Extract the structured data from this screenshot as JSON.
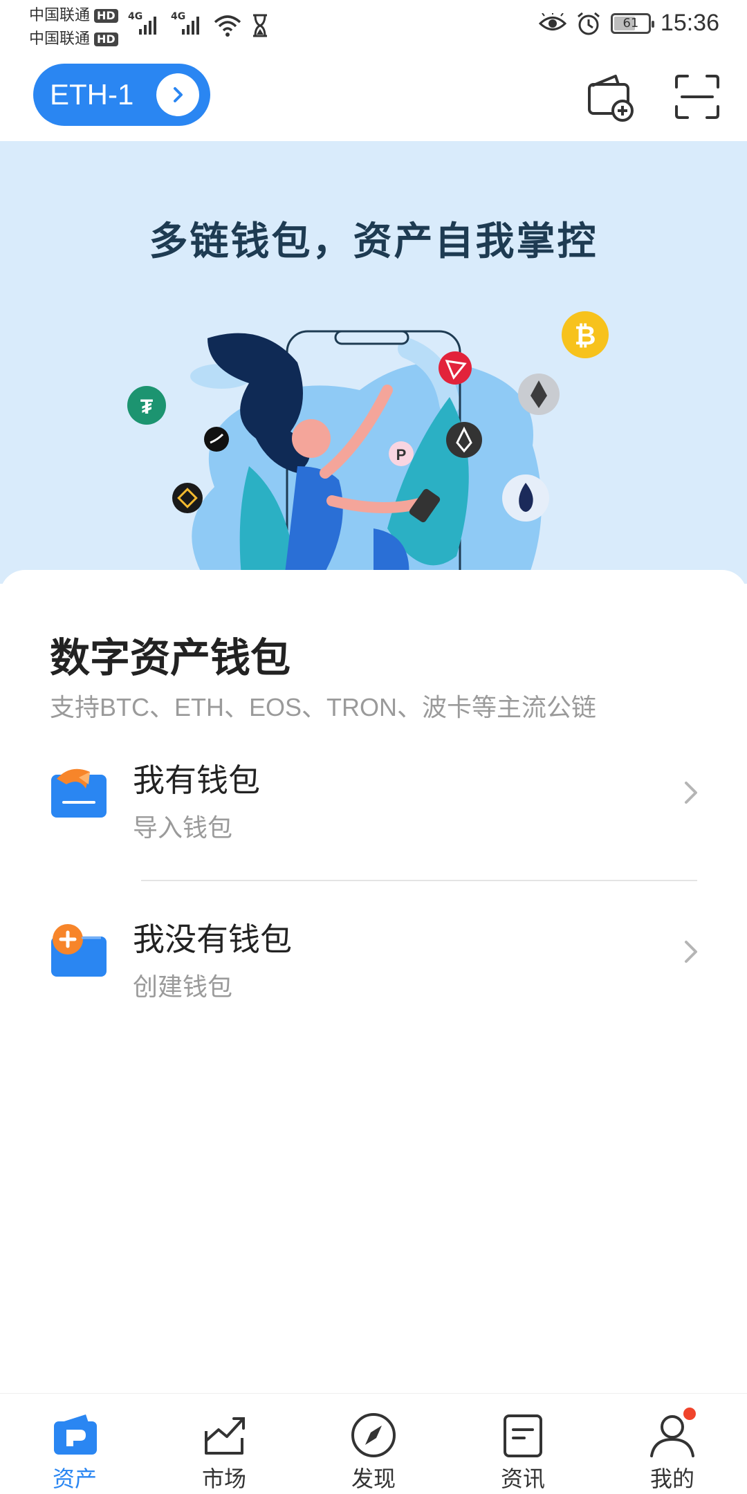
{
  "status_bar": {
    "carrier_1": "中国联通",
    "carrier_2": "中国联通",
    "hd_label": "HD",
    "net_type": "4G",
    "battery_level": "61",
    "time": "15:36"
  },
  "top_bar": {
    "chain_label": "ETH-1",
    "icons": [
      "chevron-right-icon",
      "wallet-add-icon",
      "scan-icon"
    ]
  },
  "banner": {
    "title": "多链钱包，资产自我掌控",
    "coin_icons": [
      "bitcoin-icon",
      "tron-icon",
      "ethereum-icon",
      "tether-icon",
      "eos-icon",
      "polkadot-icon",
      "binance-icon",
      "huobi-icon",
      "swift-icon"
    ]
  },
  "main": {
    "title": "数字资产钱包",
    "subtitle": "支持BTC、ETH、EOS、TRON、波卡等主流公链",
    "options": [
      {
        "title": "我有钱包",
        "subtitle": "导入钱包",
        "icon": "import-wallet-icon"
      },
      {
        "title": "我没有钱包",
        "subtitle": "创建钱包",
        "icon": "create-wallet-icon"
      }
    ]
  },
  "bottom_nav": {
    "items": [
      {
        "label": "资产",
        "icon": "wallet-icon",
        "active": true
      },
      {
        "label": "市场",
        "icon": "market-chart-icon",
        "active": false
      },
      {
        "label": "发现",
        "icon": "compass-icon",
        "active": false
      },
      {
        "label": "资讯",
        "icon": "news-icon",
        "active": false
      },
      {
        "label": "我的",
        "icon": "profile-icon",
        "active": false,
        "badge": true
      }
    ]
  },
  "colors": {
    "accent": "#2a86f2",
    "banner_bg": "#d9ebfb",
    "orange": "#f7852a",
    "badge_red": "#f0442c"
  }
}
